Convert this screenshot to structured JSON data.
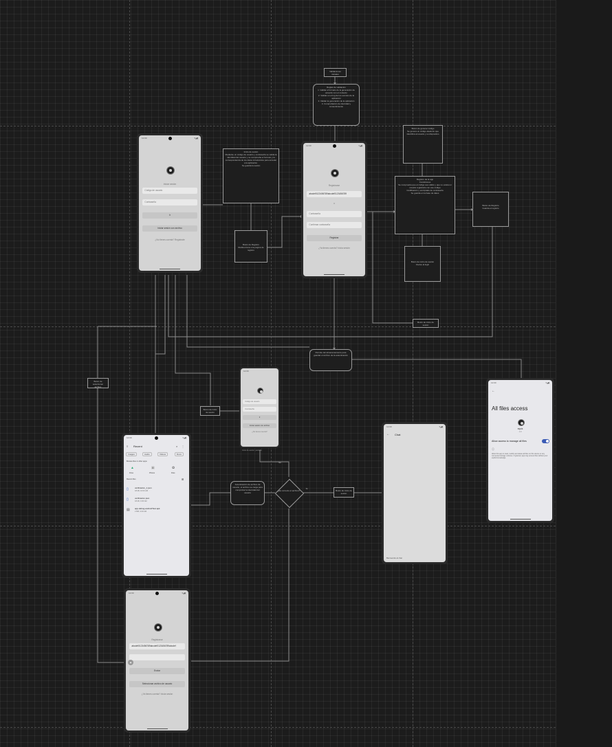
{
  "nodes": {
    "top_small": "Validaciones iniciales",
    "top_rounded": "Reglas de validación\n1. Validar el formato de la generación de acuerdo con el contexto\n2. Validar en el log de los eventos de la aplicación\n3. Validar la generación de la aplicación\n4. Comprobación de identidad y consentimiento",
    "desc_login": "Inicio de sesión\nMediante un código de usuario y contraseña se valida la identidad del usuario y se comprueba el formato y la correspondencia de los datos introducidos para acceder a la aplicación.\nSe guarda la sesión",
    "reg_tag": "Botón de Registro\nRedirecciona a la página de registro",
    "right_top": "Botón de generar código\nSe genera un código aleatorio que identifica al usuario y su dispositivo",
    "right_mid": "Registro de la app\nCondiciones\nSe comprueba que el código sea válido y que no exista un usuario registrado con ese código\nCodificación y encriptado de contraseña\nSe guarda en la base de datos",
    "right_far": "Botón de Registro\nGuarda el registro",
    "right_bottom": "Botón de inicio de sesión\nVuelve al login",
    "small_mid": "Botón de inicio de sesión",
    "center_round": "Permite del almacenamiento para guardar el archivo de la autenticación",
    "left_tag": "Botón de seleccionar archivo",
    "mini_tag": "Botón de inicio de sesión",
    "perm_box": "Autenticación de archivo de usuario, el archivo se carga para comprobar la identidad del usuario",
    "diamond": "¿Es correcto el archivo?",
    "chat_tag": "Botón de inicio de sesión",
    "yes": "Sí",
    "no": "No"
  },
  "login": {
    "time": "12:00",
    "signal": "▾◢▮",
    "subtitle": "Iniciar sesión",
    "user_ph": "Código de usuario",
    "pass_ph": "Contraseña",
    "login_btn": "Ir",
    "file_btn": "Iniciar sesión con archivo",
    "register_link": "¿No tienes cuenta? Regístrate"
  },
  "register": {
    "time": "12:00",
    "signal": "▾◢▮",
    "subtitle": "Registrarse",
    "code": "abcdef0123456789abcdef0123456789",
    "or": "o",
    "pass_ph": "Contraseña",
    "confirm_ph": "Confirmar contraseña",
    "register_btn": "Registrar",
    "login_link": "¿Ya tienes cuenta? Inicia sesión"
  },
  "mini": {
    "time": "12:00",
    "fld1": "Código de usuario",
    "fld2": "Contraseña",
    "btn1": "Ir",
    "btn2": "Iniciar sesión con archivo",
    "link": "¿No tienes cuenta?",
    "caption": "Inicio de sesión: pantalla"
  },
  "files": {
    "time": "12:00",
    "title": "Recent",
    "chips": [
      "Images",
      "Audio",
      "Videos",
      "Docs"
    ],
    "section": "Browse files in other apps",
    "apps": [
      "Drive",
      "Photos",
      "Files"
    ],
    "recent_label": "Recent files",
    "items": [
      {
        "name": "verificacion_1.json",
        "meta": "18 kB, 10:00 AM"
      },
      {
        "name": "verificacion.json",
        "meta": "18 kB, 9:45 AM"
      },
      {
        "name": "app-debug-androidTest.apk",
        "meta": "2 MB, 9:30 AM"
      }
    ]
  },
  "chat": {
    "time": "12:00",
    "title": "Chat",
    "footer": "Bienvenido al chat"
  },
  "allfiles": {
    "time": "12:00",
    "signal": "▾◢▮",
    "title": "All files access",
    "app_name": "equis",
    "app_ver": "1.0",
    "toggle_label": "Allow access to manage all files",
    "description": "Allow this app to read, modify and delete all files on this device or any connected storage volumes. If granted, app may access files without your explicit knowledge."
  },
  "login2": {
    "time": "12:00",
    "signal": "▾◢▮",
    "subtitle": "Registrarse",
    "code": "abcdef0123456789abcdef0123456789abcdef",
    "pass_ph": "",
    "login_btn": "Enviar",
    "file_btn": "Seleccionar archivo de usuario",
    "link": "¿Ya tienes cuenta? Inicia sesión"
  }
}
